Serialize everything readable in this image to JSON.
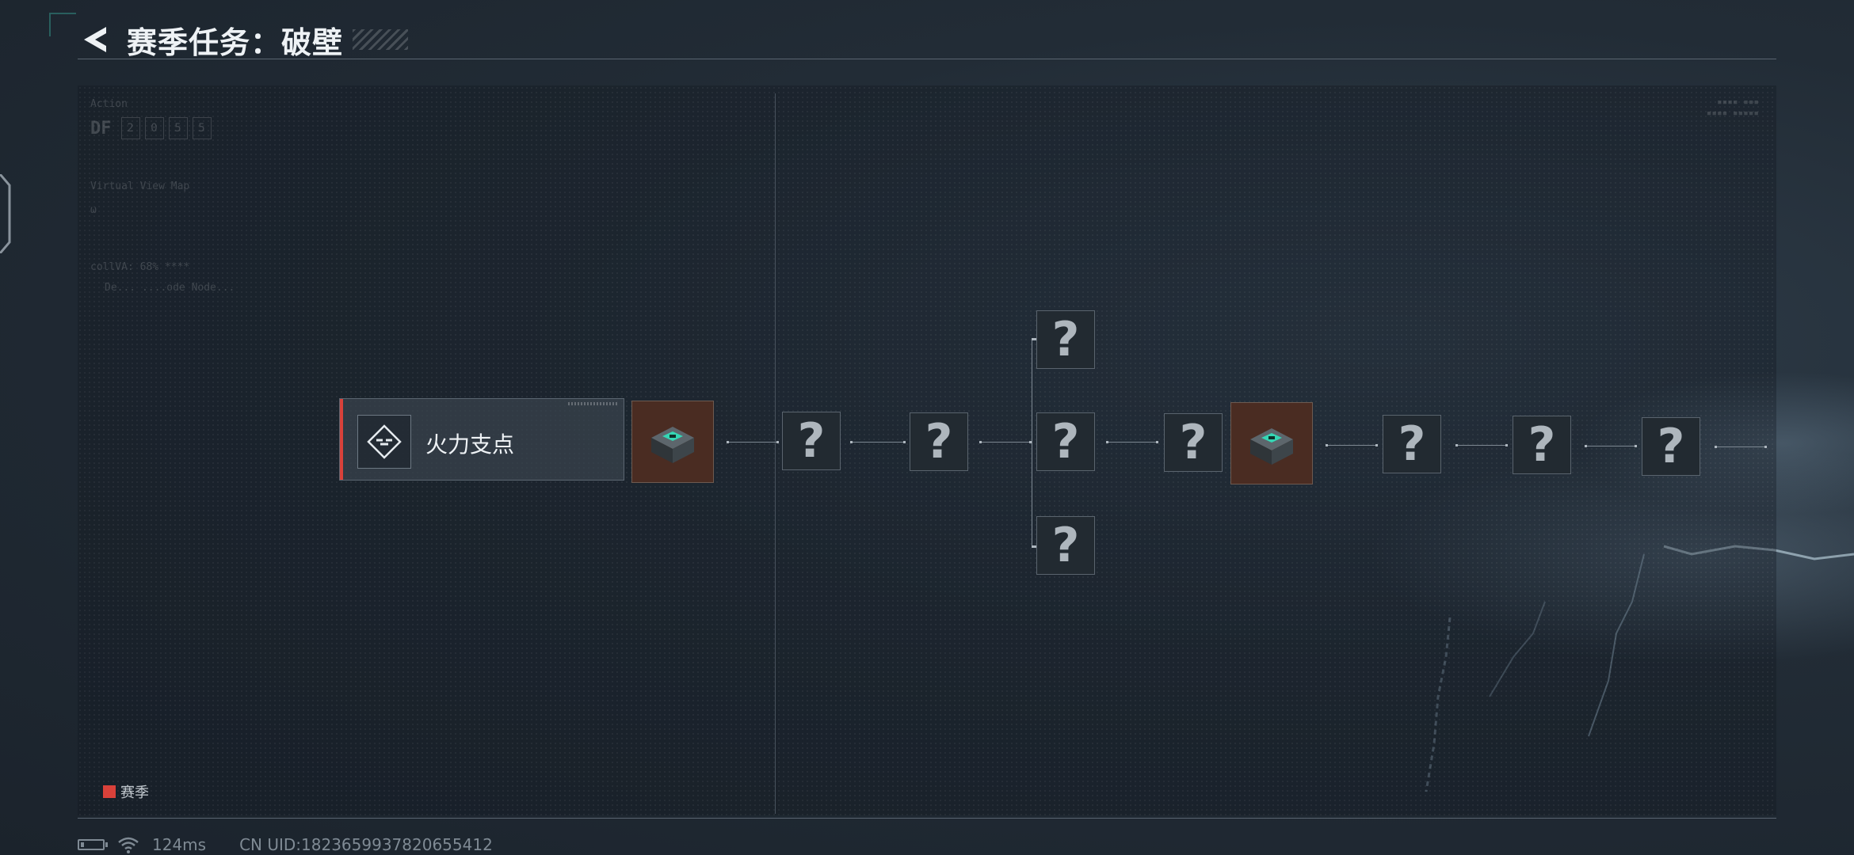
{
  "header": {
    "title": "赛季任务：破壁"
  },
  "panel": {
    "hud_text_1": "Action",
    "hud_code": [
      "DF",
      "2",
      "0",
      "5",
      "5"
    ],
    "hud_text_2": "Virtual View Map",
    "hud_text_3": "ω",
    "hud_text_4": "collVA: 68%  ****",
    "hud_text_5": "De...  ....ode Node..."
  },
  "quest_chain": {
    "start_node": {
      "label": "火力支点",
      "icon": "fire-support-icon"
    },
    "first_reward": {
      "icon": "supply-crate-icon"
    },
    "mid_reward": {
      "icon": "supply-crate-icon"
    },
    "locked_symbol": "?",
    "locked_count": 9
  },
  "legend": {
    "swatch_color": "#d9413a",
    "label": "赛季"
  },
  "status_bar": {
    "latency": "124ms",
    "uid": "CN UID:1823659937820655412"
  },
  "colors": {
    "accent_red": "#d9413a",
    "reward_bg": "#4a2c22",
    "node_bg": "#222a31"
  }
}
